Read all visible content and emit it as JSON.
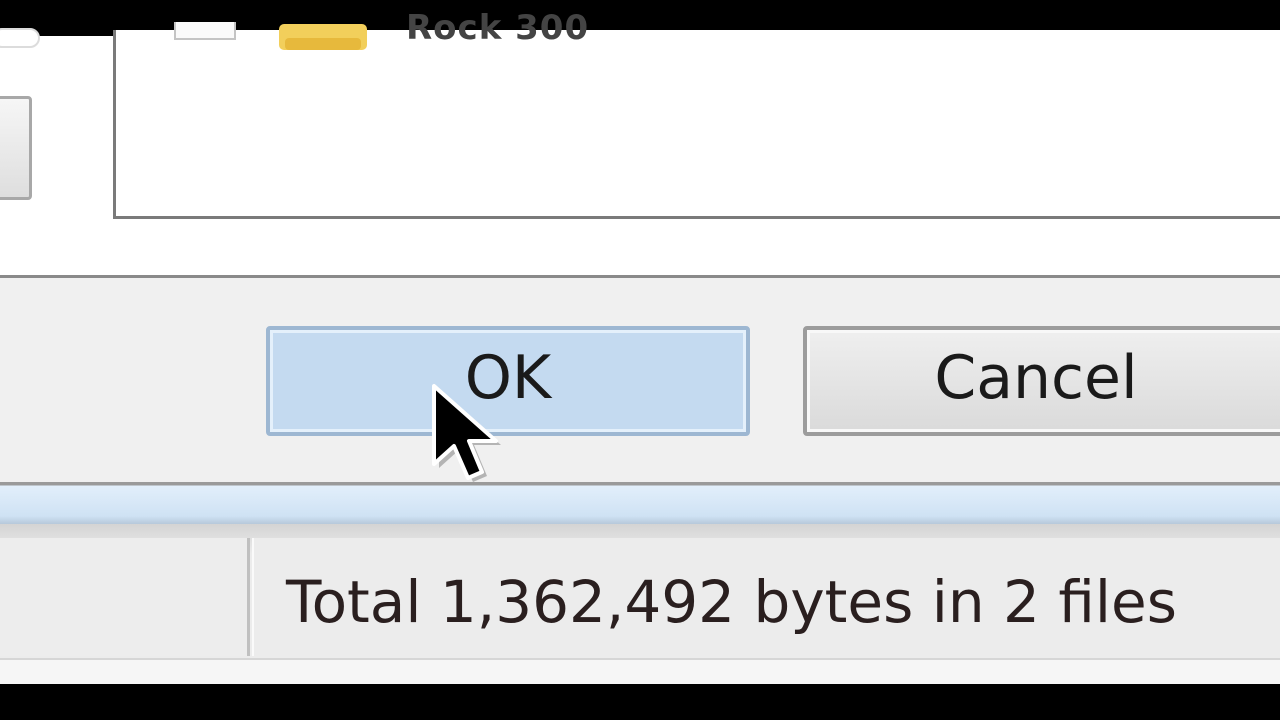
{
  "dialog": {
    "file_row_label": "Rock 300",
    "ok_label": "OK",
    "cancel_label": "Cancel"
  },
  "status_bar": {
    "summary": "Total 1,362,492 bytes in 2 files"
  },
  "colors": {
    "ok_button_fill": "#c4daf0",
    "folder_icon": "#f2cf5b",
    "status_text": "#2a1f1f"
  },
  "icons": {
    "folder": "folder-icon",
    "cursor": "mouse-pointer-icon"
  }
}
